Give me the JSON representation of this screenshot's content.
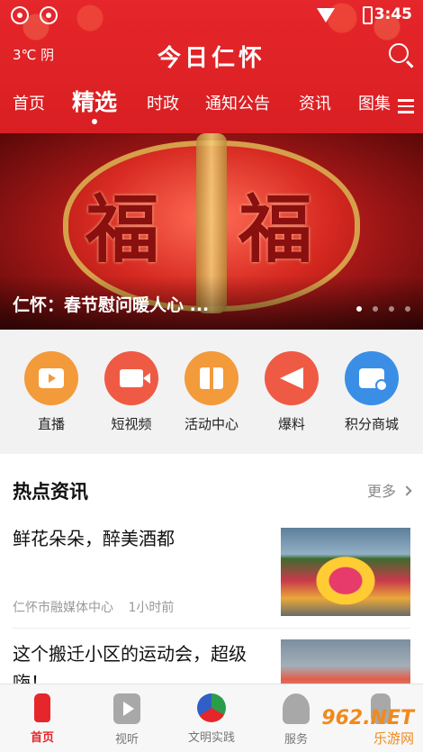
{
  "status_bar": {
    "time": "3:45"
  },
  "header": {
    "weather": "3℃ 阴",
    "title": "今日仁怀",
    "tabs": [
      {
        "label": "首页",
        "active": false
      },
      {
        "label": "精选",
        "active": true
      },
      {
        "label": "时政",
        "active": false
      },
      {
        "label": "通知公告",
        "active": false
      },
      {
        "label": "资讯",
        "active": false
      },
      {
        "label": "图集",
        "active": false
      }
    ]
  },
  "banner": {
    "title": "仁怀：春节慰问暖人心 ...",
    "lantern_text": "福",
    "page_count": 4,
    "current_page": 1
  },
  "shortcuts": [
    {
      "label": "直播",
      "icon": "tv-icon",
      "color": "#f39a3b"
    },
    {
      "label": "短视频",
      "icon": "video-camera-icon",
      "color": "#ef5a45"
    },
    {
      "label": "活动中心",
      "icon": "gift-icon",
      "color": "#f39a3b"
    },
    {
      "label": "爆料",
      "icon": "megaphone-icon",
      "color": "#ef5a45"
    },
    {
      "label": "积分商城",
      "icon": "shop-icon",
      "color": "#3a8ee6"
    }
  ],
  "news": {
    "heading": "热点资讯",
    "more_label": "更多",
    "items": [
      {
        "headline": "鲜花朵朵，醉美酒都",
        "source": "仁怀市融媒体中心",
        "time": "1小时前"
      },
      {
        "headline": "这个搬迁小区的运动会，超级嗨！",
        "source": "",
        "time": ""
      }
    ]
  },
  "bottom_nav": [
    {
      "label": "首页",
      "icon": "home-bottle-icon",
      "active": true
    },
    {
      "label": "视听",
      "icon": "play-icon",
      "active": false
    },
    {
      "label": "文明实践",
      "icon": "civilization-logo-icon",
      "active": false
    },
    {
      "label": "服务",
      "icon": "service-icon",
      "active": false
    },
    {
      "label": "",
      "icon": "user-icon",
      "active": false
    }
  ],
  "watermark": {
    "text": "962.NET",
    "sub": "乐游网"
  },
  "colors": {
    "brand_red": "#e5262a",
    "text_dark": "#111111",
    "meta_gray": "#999999"
  }
}
